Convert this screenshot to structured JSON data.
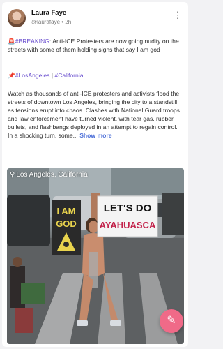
{
  "post": {
    "author_name": "Laura Faye",
    "author_handle": "@laurafaye",
    "separator": "•",
    "time": "2h",
    "breaking_emoji": "🚨",
    "breaking_tag": "#BREAKING",
    "headline": ": Anti-ICE Protesters are now going nudity on the streets with some of them holding signs that say I am god",
    "pin_emoji": "📌",
    "tags": [
      "#LosAngeles",
      "#California"
    ],
    "tag_divider": " | ",
    "body": "Watch as thousands of anti-ICE protesters and activists flood the streets of downtown Los Angeles, bringing the city to a standstill as tensions erupt into chaos. Clashes with National Guard troops and law enforcement have turned violent, with tear gas, rubber bullets, and flashbangs deployed in an attempt to regain control. In a shocking turn, some...",
    "show_more": "Show more"
  },
  "media": {
    "location": "Los Angeles, California",
    "sign_left": [
      "I AM",
      "GOD"
    ],
    "sign_right": [
      "LET'S DO",
      "AYAHUASCA"
    ]
  },
  "icons": {
    "pin": "location-pin-icon",
    "compose": "pencil-compose-icon",
    "more": "more-options-icon"
  },
  "colors": {
    "hashtag": "#6a4fcf",
    "show_more": "#4c6fd8",
    "fab": "#f06a88"
  }
}
